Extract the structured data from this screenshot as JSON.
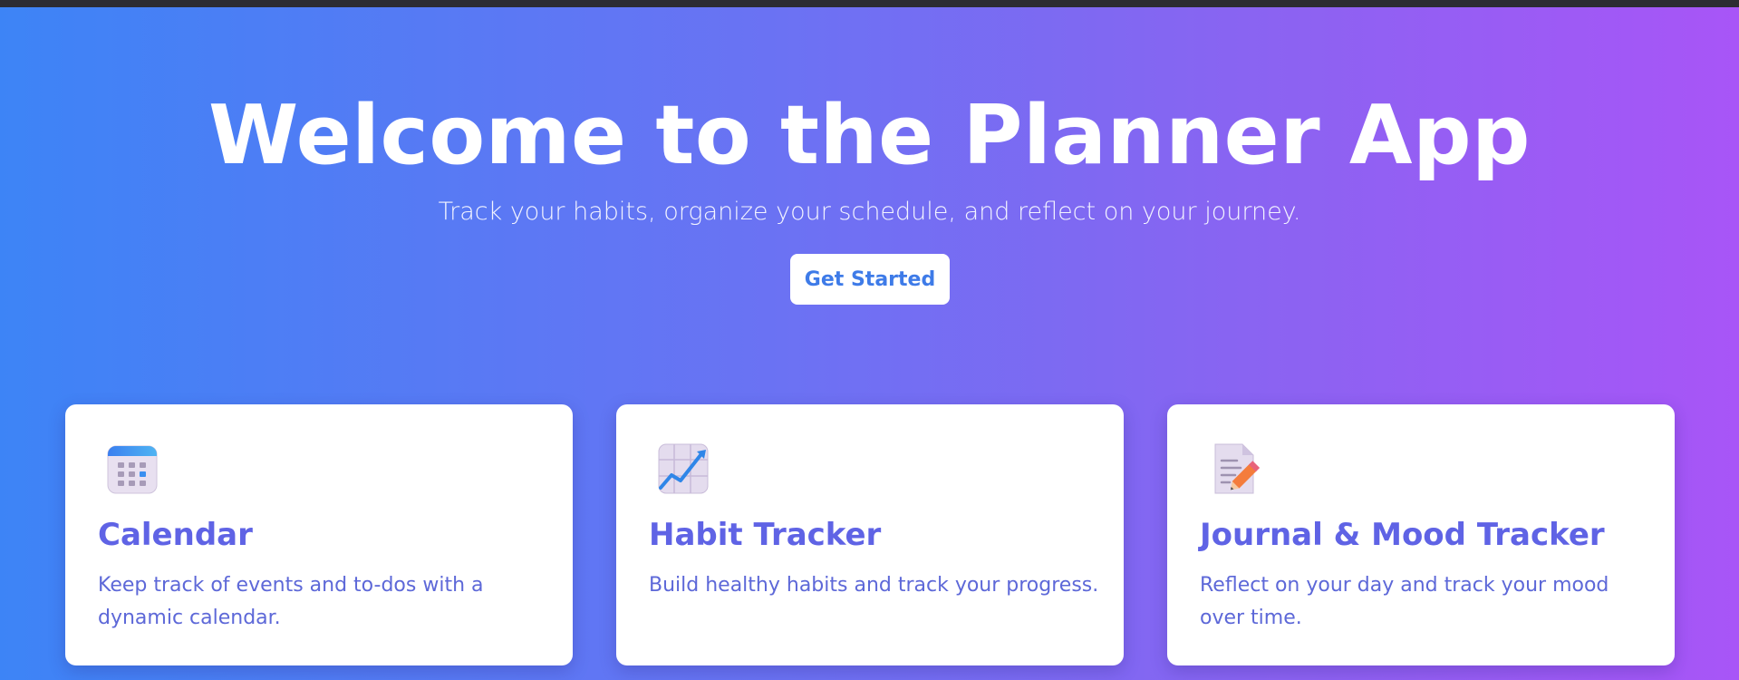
{
  "hero": {
    "title": "Welcome to the Planner App",
    "subtitle": "Track your habits, organize your schedule, and reflect on your journey.",
    "cta_label": "Get Started"
  },
  "features": [
    {
      "icon": "calendar-icon",
      "title": "Calendar",
      "description": "Keep track of events and to-dos with a dynamic calendar."
    },
    {
      "icon": "chart-increasing-icon",
      "title": "Habit Tracker",
      "description": "Build healthy habits and track your progress."
    },
    {
      "icon": "memo-pencil-icon",
      "title": "Journal & Mood Tracker",
      "description": "Reflect on your day and track your mood over time."
    }
  ],
  "colors": {
    "gradient_start": "#3d84f6",
    "gradient_end": "#a855f7",
    "card_title": "#5f63e5",
    "card_text": "#5d68d8",
    "button_text": "#3e7be8"
  }
}
